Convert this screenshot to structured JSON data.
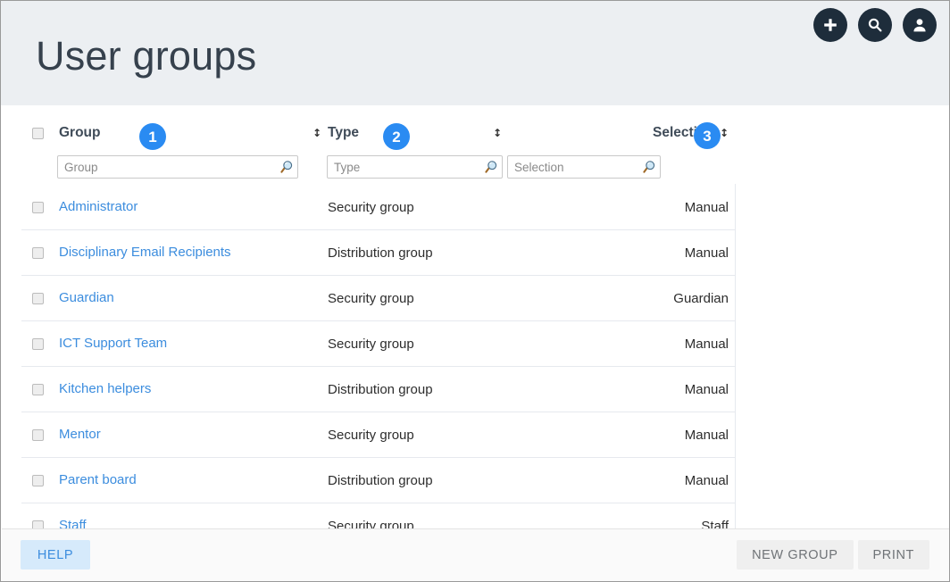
{
  "header": {
    "title": "User groups",
    "actions": [
      {
        "name": "add-icon",
        "label": "Add"
      },
      {
        "name": "search-icon",
        "label": "Search"
      },
      {
        "name": "account-icon",
        "label": "Account"
      }
    ]
  },
  "table": {
    "columns": [
      {
        "key": "group",
        "label": "Group",
        "sortable": true,
        "align": "left"
      },
      {
        "key": "type",
        "label": "Type",
        "sortable": true,
        "align": "left"
      },
      {
        "key": "selection",
        "label": "Selection",
        "sortable": true,
        "align": "right"
      }
    ],
    "filters": {
      "group_placeholder": "Group",
      "type_placeholder": "Type",
      "selection_placeholder": "Selection",
      "group_value": "",
      "type_value": "",
      "selection_value": ""
    },
    "sort_glyph": "↕",
    "rows": [
      {
        "group": "Administrator",
        "type": "Security group",
        "selection": "Manual"
      },
      {
        "group": "Disciplinary Email Recipients",
        "type": "Distribution group",
        "selection": "Manual"
      },
      {
        "group": "Guardian",
        "type": "Security group",
        "selection": "Guardian"
      },
      {
        "group": "ICT Support Team",
        "type": "Security group",
        "selection": "Manual"
      },
      {
        "group": "Kitchen helpers",
        "type": "Distribution group",
        "selection": "Manual"
      },
      {
        "group": "Mentor",
        "type": "Security group",
        "selection": "Manual"
      },
      {
        "group": "Parent board",
        "type": "Distribution group",
        "selection": "Manual"
      },
      {
        "group": "Staff",
        "type": "Security group",
        "selection": "Staff"
      }
    ]
  },
  "badges": [
    {
      "number": "1"
    },
    {
      "number": "2"
    },
    {
      "number": "3"
    }
  ],
  "footer": {
    "help_label": "HELP",
    "new_group_label": "NEW GROUP",
    "print_label": "PRINT"
  },
  "colors": {
    "header_background": "#eceff2",
    "title_text": "#36414d",
    "icon_circle": "#1e2d3b",
    "link_blue": "#3c8dde",
    "badge_blue": "#2a8bf2",
    "help_background": "#d6eafb",
    "footer_background": "#fafafa",
    "row_divider": "#e6e9ee"
  }
}
